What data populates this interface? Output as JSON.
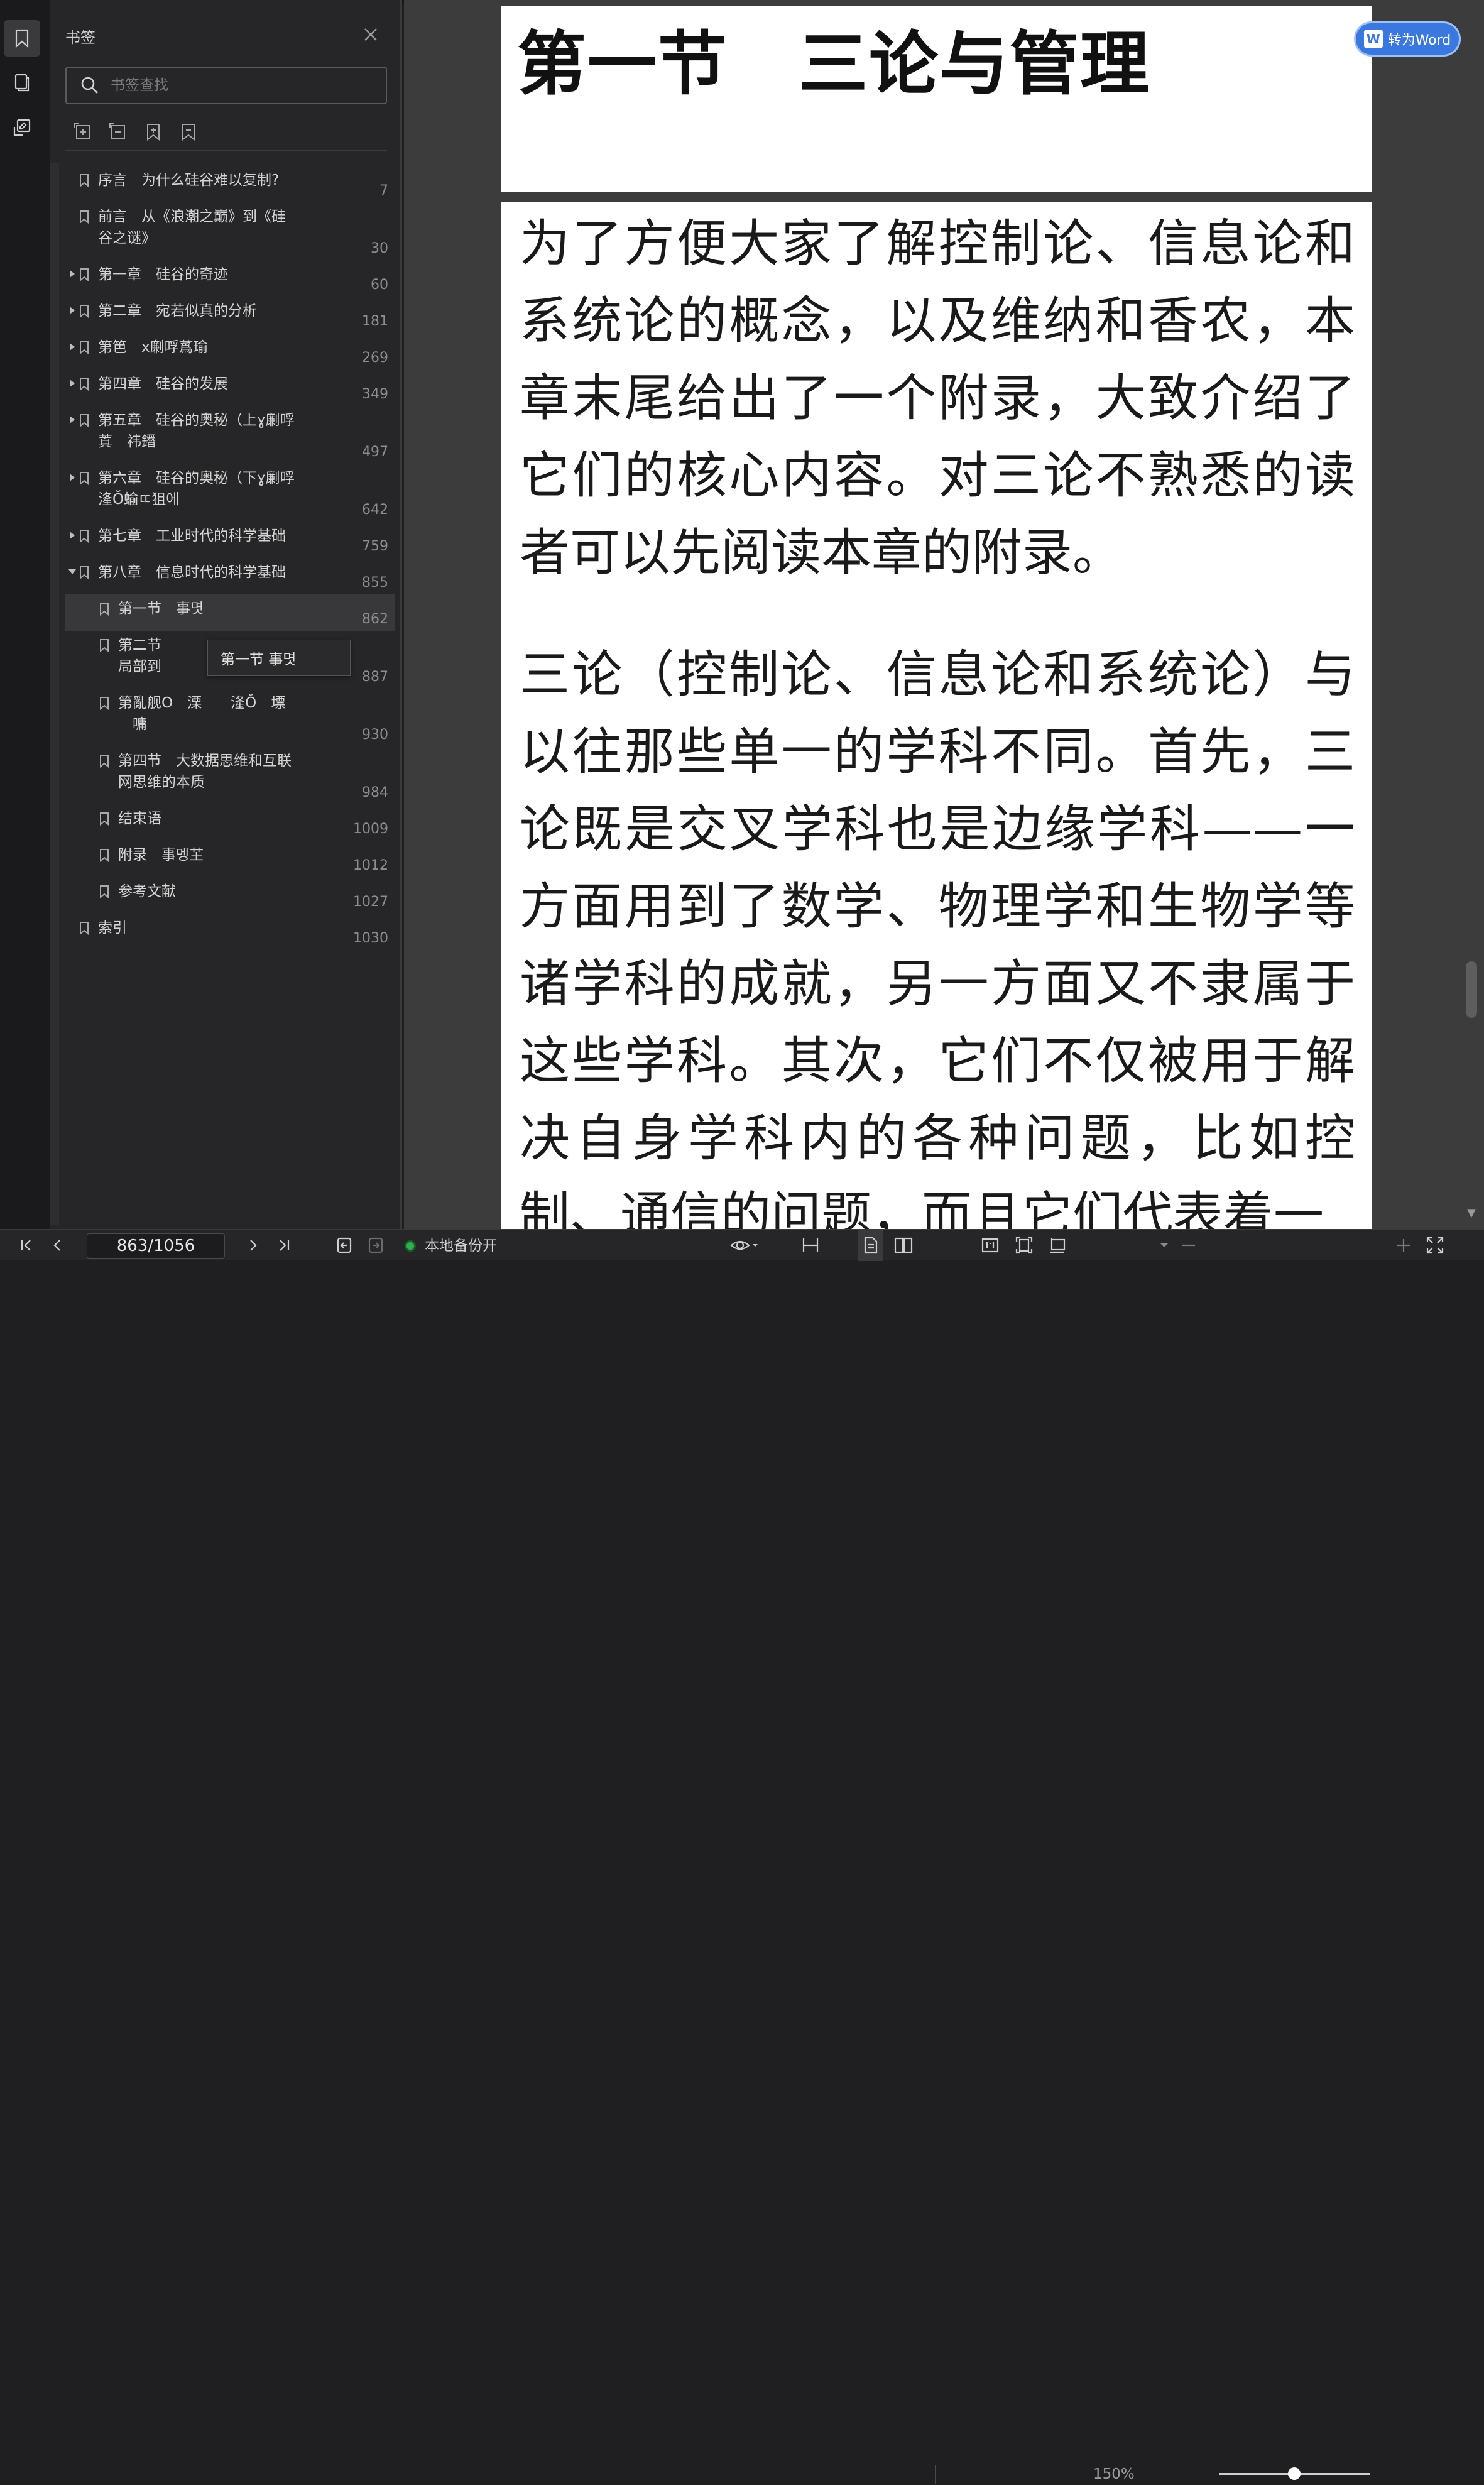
{
  "rail": {
    "icons": [
      "bookmark-icon",
      "pages-icon",
      "annotation-icon"
    ]
  },
  "panel": {
    "title": "书签",
    "search_placeholder": "书签查找",
    "tool_icons": [
      "expand-all-icon",
      "collapse-all-icon",
      "add-bookmark-icon",
      "remove-bookmark-icon"
    ],
    "items": [
      {
        "label": "序言　为什么硅谷难以复制?",
        "page": "7"
      },
      {
        "label": "前言　从《浪潮之巅》到《硅\n谷之谜》",
        "page": "30"
      },
      {
        "label": "第一章　硅谷的奇迹",
        "page": "60"
      },
      {
        "label": "第二章　宛若似真的分析",
        "page": "181"
      },
      {
        "label": "第笆　x劆哹蔿瑜",
        "page": "269"
      },
      {
        "label": "第四章　硅谷的发展",
        "page": "349"
      },
      {
        "label": "第五章　硅谷的奥秘（上ɣ劆哹\n蒖　祎鐕",
        "page": "497"
      },
      {
        "label": "第六章　硅谷的奥秘（下ɣ劆哹\n湰Ŏ蝓ㄸ狙에",
        "page": "642"
      },
      {
        "label": "第七章　工业时代的科学基础",
        "page": "759"
      },
      {
        "label": "第八章　信息时代的科学基础",
        "page": "855"
      },
      {
        "label": "第一节　事몃",
        "page": "862"
      },
      {
        "label": "第二节\n局部到",
        "page": "887"
      },
      {
        "label": "第亂舰O　溧　　湰Ŏ　墂\n　嘃",
        "page": "930"
      },
      {
        "label": "第四节　大数据思维和互联\n网思维的本质",
        "page": "984"
      },
      {
        "label": "结束语",
        "page": "1009"
      },
      {
        "label": "附录　事멩芏",
        "page": "1012"
      },
      {
        "label": "参考文献",
        "page": "1027"
      },
      {
        "label": "索引",
        "page": "1030"
      }
    ],
    "tooltip": "第一节 事몃"
  },
  "document": {
    "section_title": "第一节　三论与管理",
    "paragraphs": [
      "为了方便大家了解控制论、信息论和系统论的概念，以及维纳和香农，本章末尾给出了一个附录，大致介绍了它们的核心内容。对三论不熟悉的读者可以先阅读本章的附录。",
      "三论（控制论、信息论和系统论）与以往那些单一的学科不同。首先，三论既是交叉学科也是边缘学科——一方面用到了数学、物理学和生物学等诸学科的成就，另一方面又不隶属于这些学科。其次，它们不仅被用于解决自身学科内的各种问题，比如控制、通信的问题，而且它们代表着一"
    ],
    "to_word_label": "转为Word"
  },
  "bottombar": {
    "page_value": "863/1056",
    "backup_label": "本地备份开",
    "zoom_label": "150%",
    "zoom_level_fraction": 0.5,
    "icons": [
      "first-page-icon",
      "prev-page-icon",
      "next-page-icon",
      "last-page-icon",
      "back-icon",
      "forward-icon",
      "eye-icon",
      "continuous-scroll-icon",
      "single-page-icon",
      "dual-page-icon",
      "actual-size-icon",
      "fit-page-icon",
      "rotate-icon",
      "zoom-out-icon",
      "zoom-in-icon",
      "fullscreen-icon"
    ]
  },
  "colors": {
    "accent": "#3a78e0",
    "backup_on": "#2fb04c"
  }
}
